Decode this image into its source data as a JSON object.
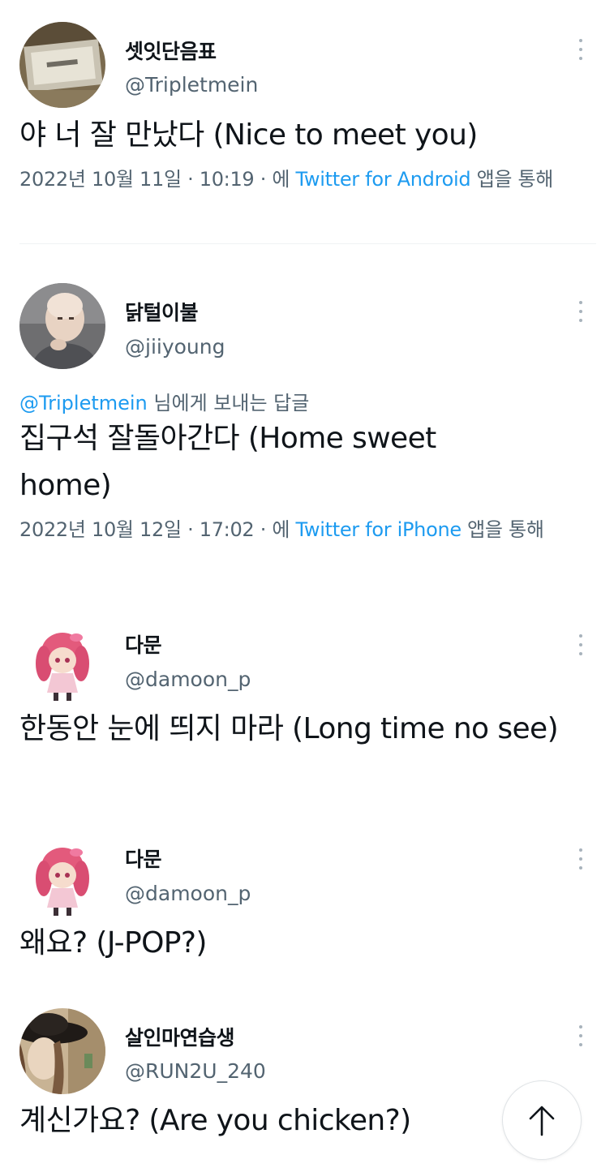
{
  "tweets": [
    {
      "name": "셋잇단음표",
      "handle": "@Tripletmein",
      "reply_to": null,
      "text": "야 너 잘 만났다 (Nice to meet you)",
      "date": "2022년 10월 11일 · 10:19 · 에 ",
      "source": "Twitter for Android",
      "suffix": " 앱을 통해",
      "avatar_icon": "photo-avatar-icon"
    },
    {
      "name": "닭털이불",
      "handle": "@jiiyoung",
      "reply_to": {
        "handle": "@Tripletmein",
        "text": " 님에게 보내는 답글"
      },
      "text": "집구석 잘돌아간다 (Home sweet home)",
      "date": "2022년 10월 12일 · 17:02 · 에 ",
      "source": "Twitter for iPhone",
      "suffix": " 앱을 통해",
      "avatar_icon": "bald-man-avatar-icon"
    },
    {
      "name": "다문",
      "handle": "@damoon_p",
      "reply_to": null,
      "text": "한동안 눈에 띄지 마라 (Long time no see)",
      "avatar_icon": "anime-girl-avatar-icon"
    },
    {
      "name": "다문",
      "handle": "@damoon_p",
      "reply_to": null,
      "text": "왜요? (J-POP?)",
      "avatar_icon": "anime-girl-avatar-icon"
    },
    {
      "name": "살인마연습생",
      "handle": "@RUN2U_240",
      "reply_to": null,
      "text": "계신가요? (Are you chicken?)",
      "avatar_icon": "hat-avatar-icon"
    }
  ],
  "icons": {
    "more": "more-options-icon",
    "scroll_top": "arrow-up-icon"
  },
  "colors": {
    "link": "#1d9bf0",
    "secondary_text": "#536471",
    "primary_text": "#0f1419"
  }
}
